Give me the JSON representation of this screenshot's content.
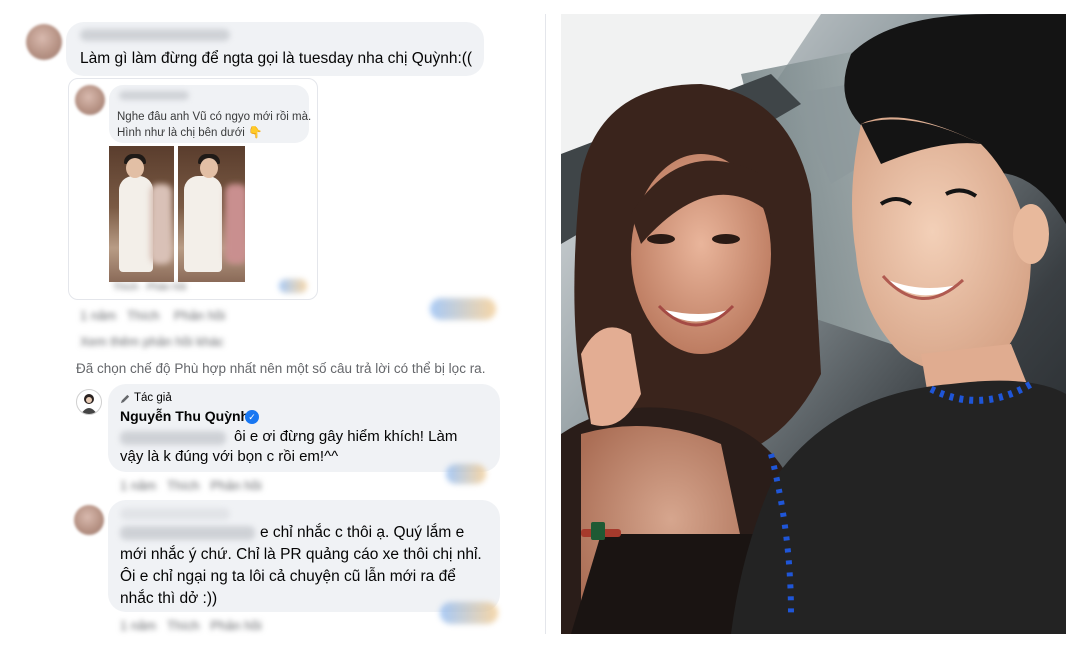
{
  "comment1": {
    "text": "Làm gì làm đừng để ngta gọi là tuesday nha chị Quỳnh:(("
  },
  "reply": {
    "line1": "Nghe đâu anh Vũ có ngyo mới rồi mà.",
    "line2": "Hình như là chị bên dưới 👇"
  },
  "filter_notice": "Đã chọn chế độ Phù hợp nhất nên một số câu trả lời có thể bị lọc ra.",
  "author_comment": {
    "badge": "Tác giả",
    "name": "Nguyễn Thu Quỳnh",
    "line1": "ôi e ơi đừng gây hiểm khích! Làm",
    "line2": "vậy là k đúng với bọn c rồi em!^^"
  },
  "comment3": {
    "line1": "e chỉ nhắc c thôi ạ. Quý lắm e",
    "line2": "mới nhắc ý chứ. Chỉ là PR quảng cáo xe thôi chị nhỉ.",
    "line3": "Ôi e chỉ ngại ng ta lôi cả chuyện cũ lẫn mới ra để",
    "line4": "nhắc thì dở :))"
  },
  "icons": [
    "pencil-icon",
    "verified-badge-icon",
    "pointing-down-emoji"
  ],
  "colors": {
    "bubble": "#f0f2f5",
    "meta_text": "#65676b",
    "verified": "#1877f2",
    "divider": "#e4e6eb"
  }
}
